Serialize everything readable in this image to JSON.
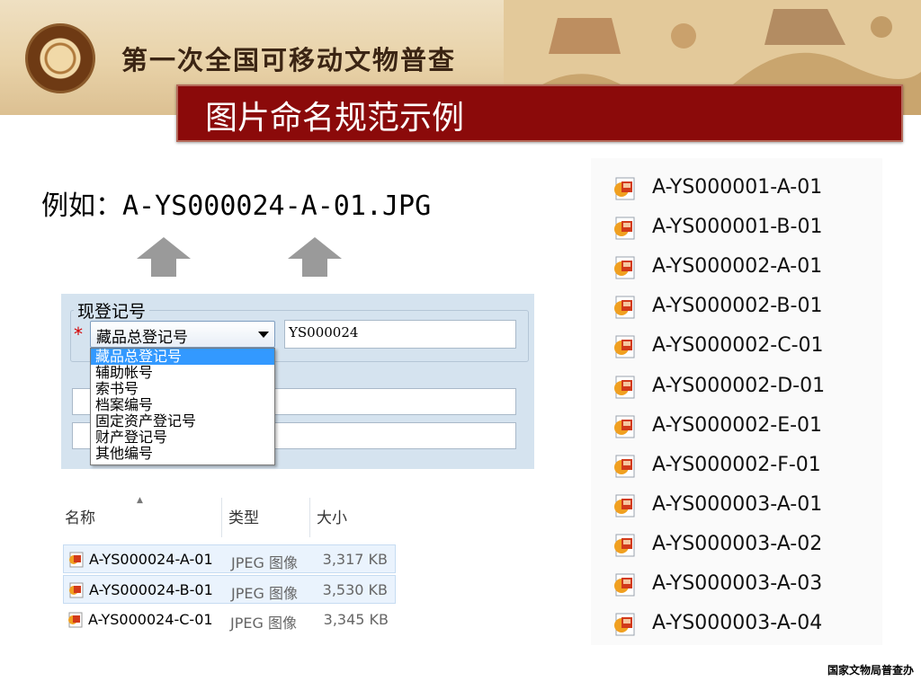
{
  "banner": {
    "title": "第一次全国可移动文物普查",
    "logo_icon": "heritage-seal-icon"
  },
  "slide": {
    "title": "图片命名规范示例",
    "example": "例如：A-YS000024-A-01.JPG",
    "footer": "国家文物局普查办"
  },
  "registration": {
    "group_label": "现登记号",
    "required_mark": "*",
    "selected_type": "藏品总登记号",
    "number_value": "YS000024",
    "options": [
      "藏品总登记号",
      "辅助帐号",
      "索书号",
      "档案编号",
      "固定资产登记号",
      "财产登记号",
      "其他编号"
    ]
  },
  "file_table": {
    "columns": [
      "名称",
      "类型",
      "大小"
    ],
    "rows": [
      {
        "name": "A-YS000024-A-01",
        "type": "JPEG 图像",
        "size": "3,317 KB"
      },
      {
        "name": "A-YS000024-B-01",
        "type": "JPEG 图像",
        "size": "3,530 KB"
      },
      {
        "name": "A-YS000024-C-01",
        "type": "JPEG 图像",
        "size": "3,345 KB"
      }
    ]
  },
  "file_list": [
    "A-YS000001-A-01",
    "A-YS000001-B-01",
    "A-YS000002-A-01",
    "A-YS000002-B-01",
    "A-YS000002-C-01",
    "A-YS000002-D-01",
    "A-YS000002-E-01",
    "A-YS000002-F-01",
    "A-YS000003-A-01",
    "A-YS000003-A-02",
    "A-YS000003-A-03",
    "A-YS000003-A-04"
  ],
  "colors": {
    "title_bar": "#8b0a0a",
    "selection": "#3399ff",
    "panel_bg": "#d5e3ef"
  }
}
